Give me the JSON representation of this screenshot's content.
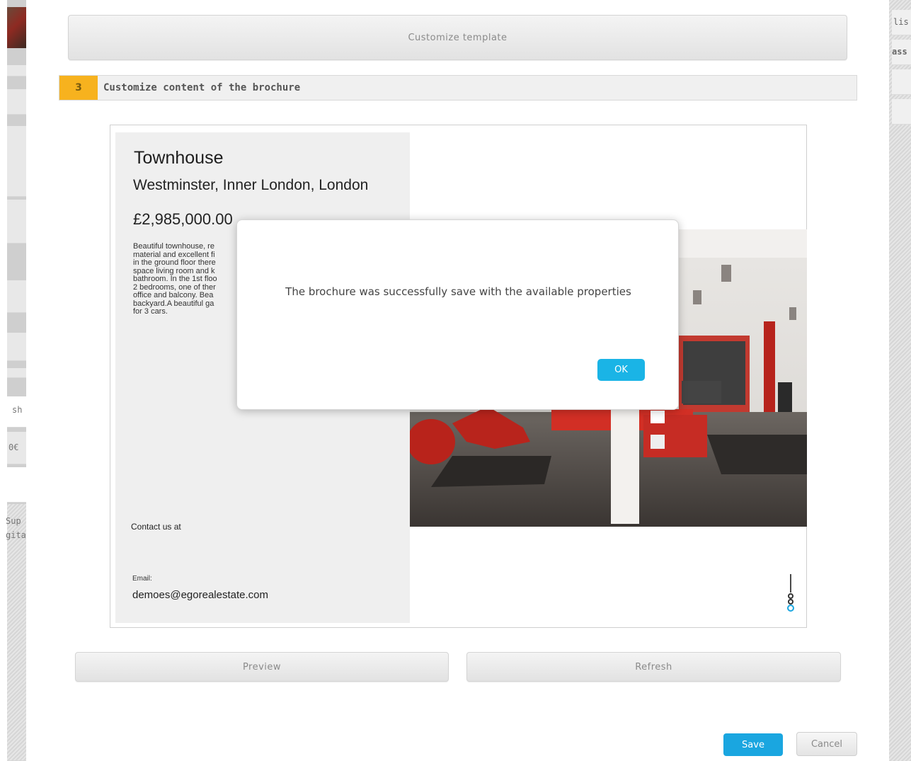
{
  "left_sidebar": {
    "snippets": [
      "sh",
      "0€",
      "Sup",
      "gita"
    ]
  },
  "right_sidebar": {
    "snippets": [
      "lis",
      "ass"
    ]
  },
  "customize_template_label": "Customize template",
  "step": {
    "number": "3",
    "title": "Customize content of the brochure"
  },
  "brochure": {
    "title": "Townhouse",
    "location": "Westminster, Inner London, London",
    "price": "£2,985,000.00",
    "description": "Beautiful townhouse, re\nmaterial and excellent fi\nin the ground floor there\nspace living room and k\nbathroom. In the 1st floo\n2 bedrooms, one of ther\noffice and balcony. Bea\nbackyard.A beautiful ga\nfor 3 cars.",
    "contact_label": "Contact us at",
    "email_label": "Email:",
    "email": "demoes@egorealestate.com"
  },
  "actions": {
    "preview_label": "Preview",
    "refresh_label": "Refresh",
    "save_label": "Save",
    "cancel_label": "Cancel"
  },
  "dialog": {
    "message": "The brochure was successfully save with the available properties",
    "ok_label": "OK"
  },
  "colors": {
    "accent": "#1aa6e0",
    "step_badge": "#f7b21e"
  }
}
